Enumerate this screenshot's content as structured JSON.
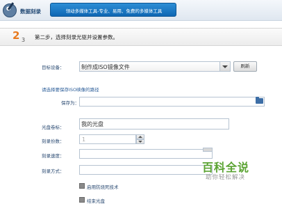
{
  "header": {
    "app_title": "数据刻录",
    "slogan": "领动多媒体工具-专业、易用、免费的多媒体工具"
  },
  "step": {
    "number": "2",
    "total": "3",
    "title": "第二步，选择刻录光驱并设置参数。"
  },
  "form": {
    "target_label": "目标设备：",
    "target_value": "制作成ISO镜像文件",
    "refresh_label": "刷新",
    "path_hint": "请选择要保存ISO映像的路径",
    "save_label": "保存为：",
    "save_value": "",
    "disc_label": "光盘卷标：",
    "disc_value": "我的光盘",
    "copies_label": "刻录份数：",
    "copies_value": "1",
    "speed_label": "刻录速度：",
    "speed_value": "",
    "mode_label": "刻录方式：",
    "mode_value": "",
    "protect_label": "启用防烧死技术",
    "close_label": "结束光盘"
  },
  "watermark": {
    "logo": "百科全说",
    "sub": "助你轻松解决"
  },
  "icons": [
    "app-logo-icon",
    "chevron-down-icon",
    "folder-icon",
    "spin-up-icon",
    "spin-down-icon"
  ],
  "colors": {
    "accent": "#1b78c8",
    "step_number": "#e87a1e",
    "label": "#2a4a72",
    "watermark_green": "#5aa332"
  }
}
